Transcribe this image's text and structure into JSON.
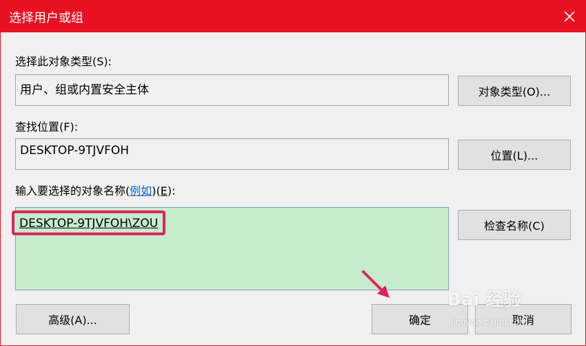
{
  "window": {
    "title": "选择用户或组"
  },
  "object_type": {
    "label": "选择此对象类型(S):",
    "value": "用户、组或内置安全主体",
    "button": "对象类型(O)..."
  },
  "location": {
    "label": "查找位置(F):",
    "value": "DESKTOP-9TJVFOH",
    "button": "位置(L)..."
  },
  "names": {
    "label_prefix": "输入要选择的对象名称(",
    "label_link": "例如",
    "label_middle": ")(",
    "label_key": "E",
    "label_suffix": "):",
    "value": "DESKTOP-9TJVFOH\\ZOU",
    "check_button": "检查名称(C)"
  },
  "footer": {
    "advanced_button": "高级(A)...",
    "ok_button": "确定",
    "cancel_button": "取消"
  },
  "watermark": {
    "brand": "Bai 经验",
    "url": "jingyan.baidu.com"
  },
  "colors": {
    "titlebar": "#e81123",
    "highlight": "#e0225c",
    "input_bg": "#c6ecce",
    "link": "#0066cc"
  }
}
